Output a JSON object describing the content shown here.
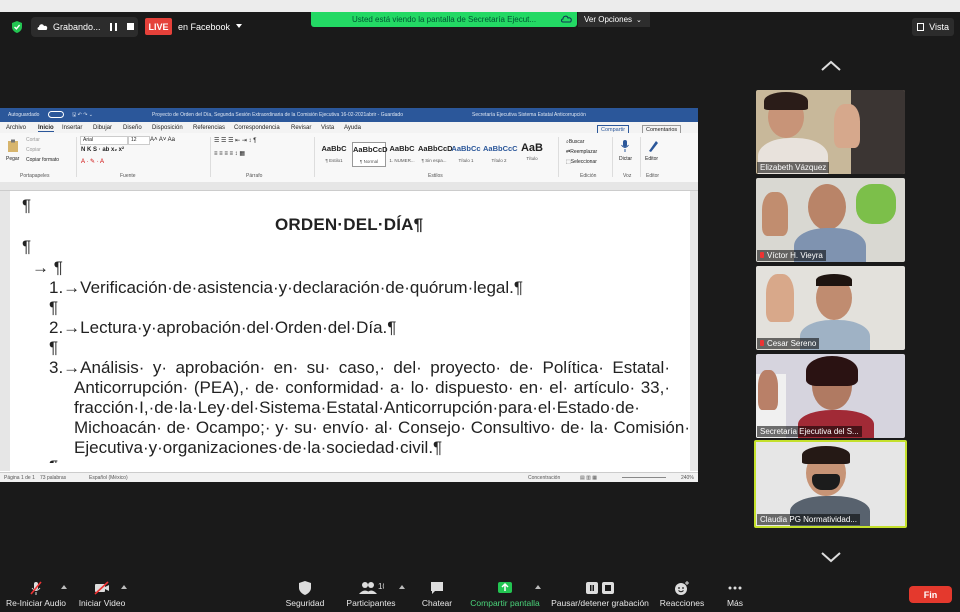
{
  "top_bar": {
    "recording_label": "Grabando...",
    "live_badge": "LIVE",
    "live_destination": "en Facebook",
    "share_banner": "Usted está viendo la pantalla de Secretaría Ejecut...",
    "view_options": "Ver Opciones",
    "view_button": "Vista"
  },
  "word": {
    "autosave": "Autoguardado",
    "doc_title": "Proyecto de Orden del Día, Segunda Sesión Extraordinaria de la Comisión Ejecutiva 16-02-2021abrir  -  Guardado",
    "account": "Secretaría Ejecutiva Sistema Estatal Anticorrupción",
    "tabs": [
      "Archivo",
      "Inicio",
      "Insertar",
      "Dibujar",
      "Diseño",
      "Disposición",
      "Referencias",
      "Correspondencia",
      "Revisar",
      "Vista",
      "Ayuda"
    ],
    "share_button": "Compartir",
    "comments_button": "Comentarios",
    "ribbon": {
      "paste": "Pegar",
      "cut": "Cortar",
      "copy": "Copiar",
      "format_painter": "Copiar formato",
      "font_name": "Arial",
      "font_size": "12",
      "styles": [
        {
          "preview": "AaBbC",
          "name": "¶ Estilo1"
        },
        {
          "preview": "AaBbCcD",
          "name": "¶ Normal"
        },
        {
          "preview": "AaBbC",
          "name": "1. NUMER..."
        },
        {
          "preview": "AaBbCcD",
          "name": "¶ Sin espa..."
        },
        {
          "preview": "AaBbCc",
          "name": "Título 1"
        },
        {
          "preview": "AaBbCcC",
          "name": "Título 2"
        },
        {
          "preview": "AaB",
          "name": "Título"
        }
      ],
      "find": "Buscar",
      "replace": "Reemplazar",
      "select": "Seleccionar",
      "dictate": "Dictar",
      "editor": "Editor",
      "group_clipboard": "Portapapeles",
      "group_font": "Fuente",
      "group_paragraph": "Párrafo",
      "group_styles": "Estilos",
      "group_editing": "Edición",
      "group_voice": "Voz",
      "group_editor": "Editor"
    },
    "document": {
      "title": "ORDEN·DEL·DÍA¶",
      "pilcrow": "¶",
      "arrow_pilcrow": "→  ¶",
      "item1": "1.→Verificación·de·asistencia·y·declaración·de·quórum·legal.¶",
      "item2": "2.→Lectura·y·aprobación·del·Orden·del·Día.¶",
      "item3_lines": [
        "3.→Análisis· y· aprobación· en· su· caso,· del· proyecto· de· Política· Estatal·",
        "Anticorrupción· (PEA),· de· conformidad· a· lo· dispuesto· en· el· artículo· 33,·",
        "fracción·I,·de·la·Ley·del·Sistema·Estatal·Anticorrupción·para·el·Estado·de·",
        "Michoacán· de· Ocampo;· y· su· envío· al· Consejo· Consultivo· de· la· Comisión·",
        "Ejecutiva·y·organizaciones·de·la·sociedad·civil.¶"
      ],
      "next_pilcrow": "¶"
    },
    "status": {
      "page": "Página 1 de 1",
      "words": "73 palabras",
      "language": "Español (México)",
      "focus": "Concentración",
      "zoom": "240%"
    }
  },
  "participants": [
    {
      "name": "Elizabeth Vázquez",
      "muted": false
    },
    {
      "name": "Víctor H. Vieyra",
      "muted": true
    },
    {
      "name": "Cesar Sereno",
      "muted": true
    },
    {
      "name": "Secretaría Ejecutiva del S...",
      "muted": false
    },
    {
      "name": "Claudia PG Normatividad...",
      "muted": false
    }
  ],
  "toolbar": {
    "unmute": "Re-Iniciar Audio",
    "start_video": "Iniciar Video",
    "security": "Seguridad",
    "participants": "Participantes",
    "participants_count": "10",
    "chat": "Chatear",
    "share": "Compartir pantalla",
    "record": "Pausar/detener grabación",
    "reactions": "Reacciones",
    "more": "Más",
    "end": "Fin"
  },
  "colors": {
    "live": "#e5413a",
    "share_green": "#23d964",
    "word_blue": "#2b579a",
    "end_red": "#e4392d",
    "active_speaker": "#c4e02c"
  }
}
